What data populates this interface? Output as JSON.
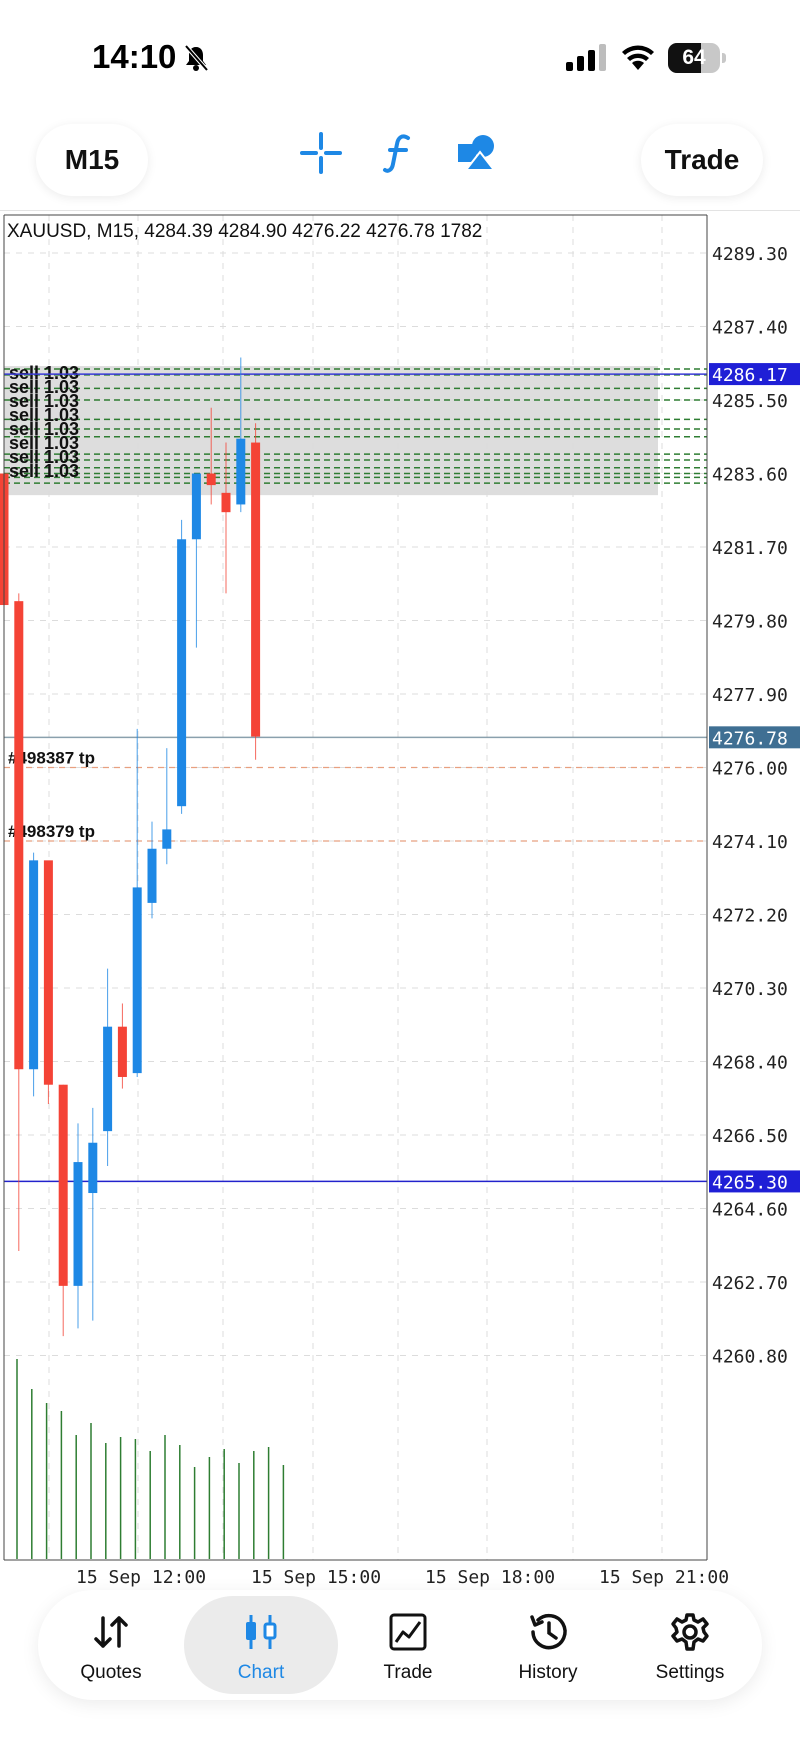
{
  "status": {
    "time": "14:10",
    "battery": "64",
    "battery_level": 0.64
  },
  "toolbar": {
    "timeframe": "M15",
    "trade_label": "Trade"
  },
  "chart_data": {
    "type": "candlestick",
    "title": "XAUUSD, M15, 4284.39 4284.90 4276.22 4276.78 1782",
    "ylim": [
      4258.5,
      4291.0
    ],
    "y_ticks": [
      "4289.30",
      "4287.40",
      "4285.50",
      "4283.60",
      "4281.70",
      "4279.80",
      "4277.90",
      "4276.00",
      "4274.10",
      "4272.20",
      "4270.30",
      "4268.40",
      "4266.50",
      "4264.60",
      "4262.70",
      "4260.80"
    ],
    "x_ticks": [
      "15 Sep 12:00",
      "15 Sep 15:00",
      "15 Sep 18:00",
      "15 Sep 21:00"
    ],
    "price_marks": [
      {
        "label": "4286.17",
        "value": 4286.17,
        "bg": "#1f1fd6",
        "line": "#3a3ad8"
      },
      {
        "label": "4276.78",
        "value": 4276.78,
        "bg": "#3f6f93",
        "line": "#8aa0ad"
      },
      {
        "label": "4265.30",
        "value": 4265.3,
        "bg": "#1f1fd6",
        "line": "#2222cc"
      }
    ],
    "candles": [
      {
        "o": 4283.6,
        "h": 4284.5,
        "l": 4280.0,
        "c": 4280.2
      },
      {
        "o": 4280.3,
        "h": 4280.5,
        "l": 4263.5,
        "c": 4268.2
      },
      {
        "o": 4268.2,
        "h": 4273.8,
        "l": 4267.5,
        "c": 4273.6
      },
      {
        "o": 4273.6,
        "h": 4273.5,
        "l": 4267.3,
        "c": 4267.8
      },
      {
        "o": 4267.8,
        "h": 4267.8,
        "l": 4261.3,
        "c": 4262.6
      },
      {
        "o": 4262.6,
        "h": 4266.8,
        "l": 4261.5,
        "c": 4265.8
      },
      {
        "o": 4265.0,
        "h": 4267.2,
        "l": 4261.7,
        "c": 4266.3
      },
      {
        "o": 4266.6,
        "h": 4270.8,
        "l": 4265.7,
        "c": 4269.3
      },
      {
        "o": 4269.3,
        "h": 4269.9,
        "l": 4267.7,
        "c": 4268.0
      },
      {
        "o": 4268.1,
        "h": 4277.0,
        "l": 4268.0,
        "c": 4272.9
      },
      {
        "o": 4272.5,
        "h": 4274.6,
        "l": 4272.1,
        "c": 4273.9
      },
      {
        "o": 4273.9,
        "h": 4276.5,
        "l": 4273.5,
        "c": 4274.4
      },
      {
        "o": 4275.0,
        "h": 4282.4,
        "l": 4274.8,
        "c": 4281.9
      },
      {
        "o": 4281.9,
        "h": 4283.6,
        "l": 4279.1,
        "c": 4283.6
      },
      {
        "o": 4283.6,
        "h": 4285.3,
        "l": 4282.8,
        "c": 4283.3
      },
      {
        "o": 4283.1,
        "h": 4284.4,
        "l": 4280.5,
        "c": 4282.6
      },
      {
        "o": 4282.8,
        "h": 4286.6,
        "l": 4282.6,
        "c": 4284.5
      },
      {
        "o": 4284.4,
        "h": 4284.9,
        "l": 4276.2,
        "c": 4276.8
      }
    ],
    "volumes": [
      1,
      0.85,
      0.78,
      0.74,
      0.62,
      0.68,
      0.58,
      0.61,
      0.6,
      0.54,
      0.62,
      0.57,
      0.46,
      0.51,
      0.55,
      0.48,
      0.54,
      0.56,
      0.47
    ],
    "sell_lines": [
      4286.3,
      4286.15,
      4285.8,
      4285.5,
      4285.0,
      4284.75,
      4284.55,
      4284.1,
      4283.95,
      4283.75,
      4283.6,
      4283.5,
      4283.35
    ],
    "sell_labels": [
      "sell 1.03",
      "sell 1.03",
      "sell 1.03",
      "sell 1.03",
      "sell 1.03",
      "sell 1.03",
      "sell 1.03",
      "sell 1.03"
    ],
    "tp_lines": [
      {
        "label": "#498387 tp",
        "value": 4276.0
      },
      {
        "label": "#498379 tp",
        "value": 4274.1
      }
    ],
    "colors": {
      "bull": "#1e88e5",
      "bear": "#f44336",
      "volume": "#2e7d32",
      "grid": "#dcdcdc",
      "sell_zone": "#d9d9d9",
      "sell_line": "#2e7d32"
    }
  },
  "tabs": [
    {
      "label": "Quotes",
      "icon": "quotes-arrows-icon"
    },
    {
      "label": "Chart",
      "icon": "candlestick-icon",
      "active": true
    },
    {
      "label": "Trade",
      "icon": "trade-chart-icon"
    },
    {
      "label": "History",
      "icon": "history-clock-icon"
    },
    {
      "label": "Settings",
      "icon": "gear-icon"
    }
  ]
}
